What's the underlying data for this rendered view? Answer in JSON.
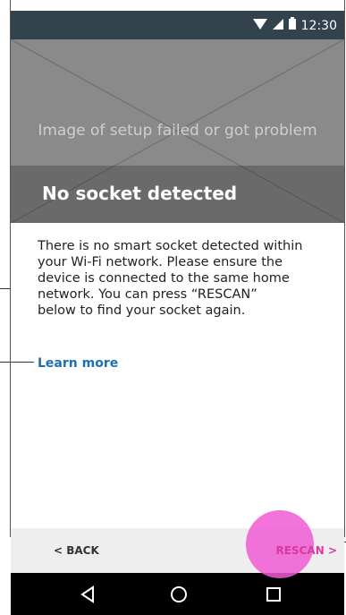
{
  "status_bar": {
    "time": "12:30",
    "icons": [
      "wifi-icon",
      "signal-icon",
      "battery-icon"
    ]
  },
  "hero": {
    "caption": "Image of setup failed or got problem"
  },
  "title": "No socket detected",
  "body": {
    "message": "There is no smart socket detected within\nyour Wi-Fi network. Please ensure the\ndevice is connected to the same home\nnetwork. You can press “RESCAN”\nbelow to find your socket again.",
    "learn_more": "Learn more"
  },
  "bottom_bar": {
    "back_label": "< BACK",
    "rescan_label": "RESCAN >"
  },
  "nav_bar": {
    "icons": [
      "back-triangle-icon",
      "home-circle-icon",
      "recents-square-icon"
    ]
  },
  "colors": {
    "status_bar": "#33434e",
    "link": "#1e6fb3",
    "touch_indicator": "#f05ad2",
    "rescan_text": "#d63aa0"
  }
}
